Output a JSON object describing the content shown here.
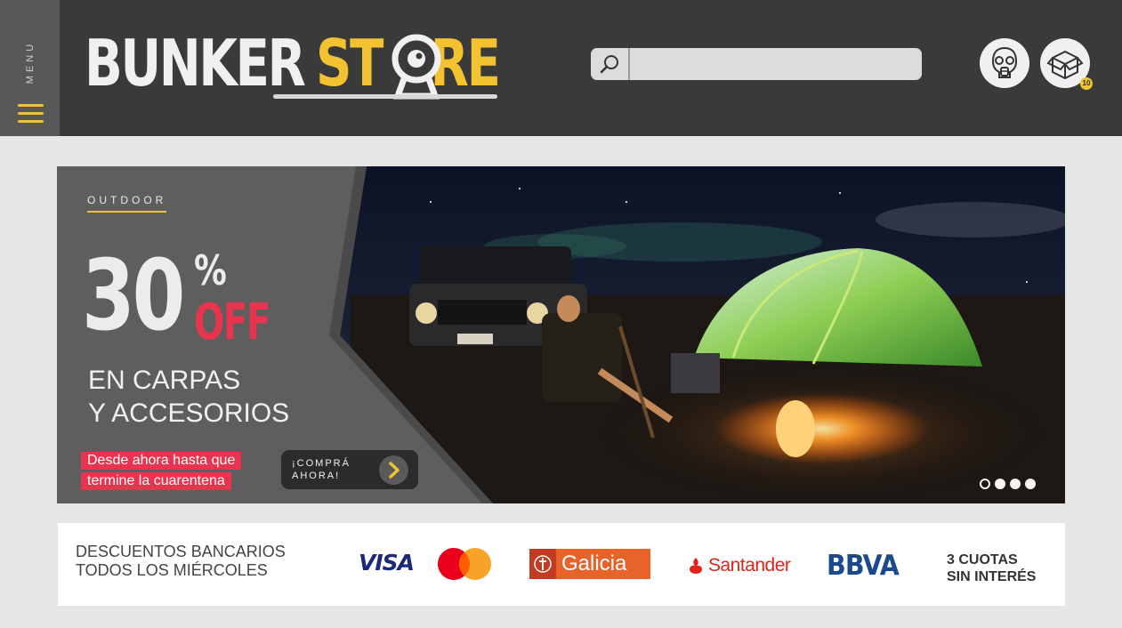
{
  "header": {
    "menu_label": "MENU",
    "brand_part1": "BUNKER",
    "brand_part2": "ST",
    "brand_part3": "RE",
    "search": {
      "value": "",
      "placeholder": "",
      "icon": "search-icon"
    },
    "account_icon": "gas-mask-icon",
    "cart_icon": "box-icon",
    "cart_count": "10"
  },
  "banner": {
    "category": "OUTDOOR",
    "discount": "30",
    "percent": "%",
    "off": "OFF",
    "headline_line1": "EN CARPAS",
    "headline_line2": "Y ACCESORIOS",
    "period_line1": "Desde ahora hasta que",
    "period_line2": "termine la cuarentena",
    "cta_line1": "¡COMPRÁ",
    "cta_line2": "AHORA!",
    "slides": 4,
    "active_slide": 1
  },
  "bank_strip": {
    "title_line1": "DESCUENTOS BANCARIOS",
    "title_line2": "TODOS LOS MIÉRCOLES",
    "visa": "VISA",
    "galicia": "Galicia",
    "santander": "Santander",
    "bbva": "BBVA",
    "cuotas_line1": "3 CUOTAS",
    "cuotas_line2": "SIN INTERÉS"
  },
  "colors": {
    "header_bg": "#3a3a3a",
    "menu_bg": "#585858",
    "accent_yellow": "#f2c230",
    "accent_red": "#e9344f",
    "page_bg": "#e6e6e6"
  }
}
